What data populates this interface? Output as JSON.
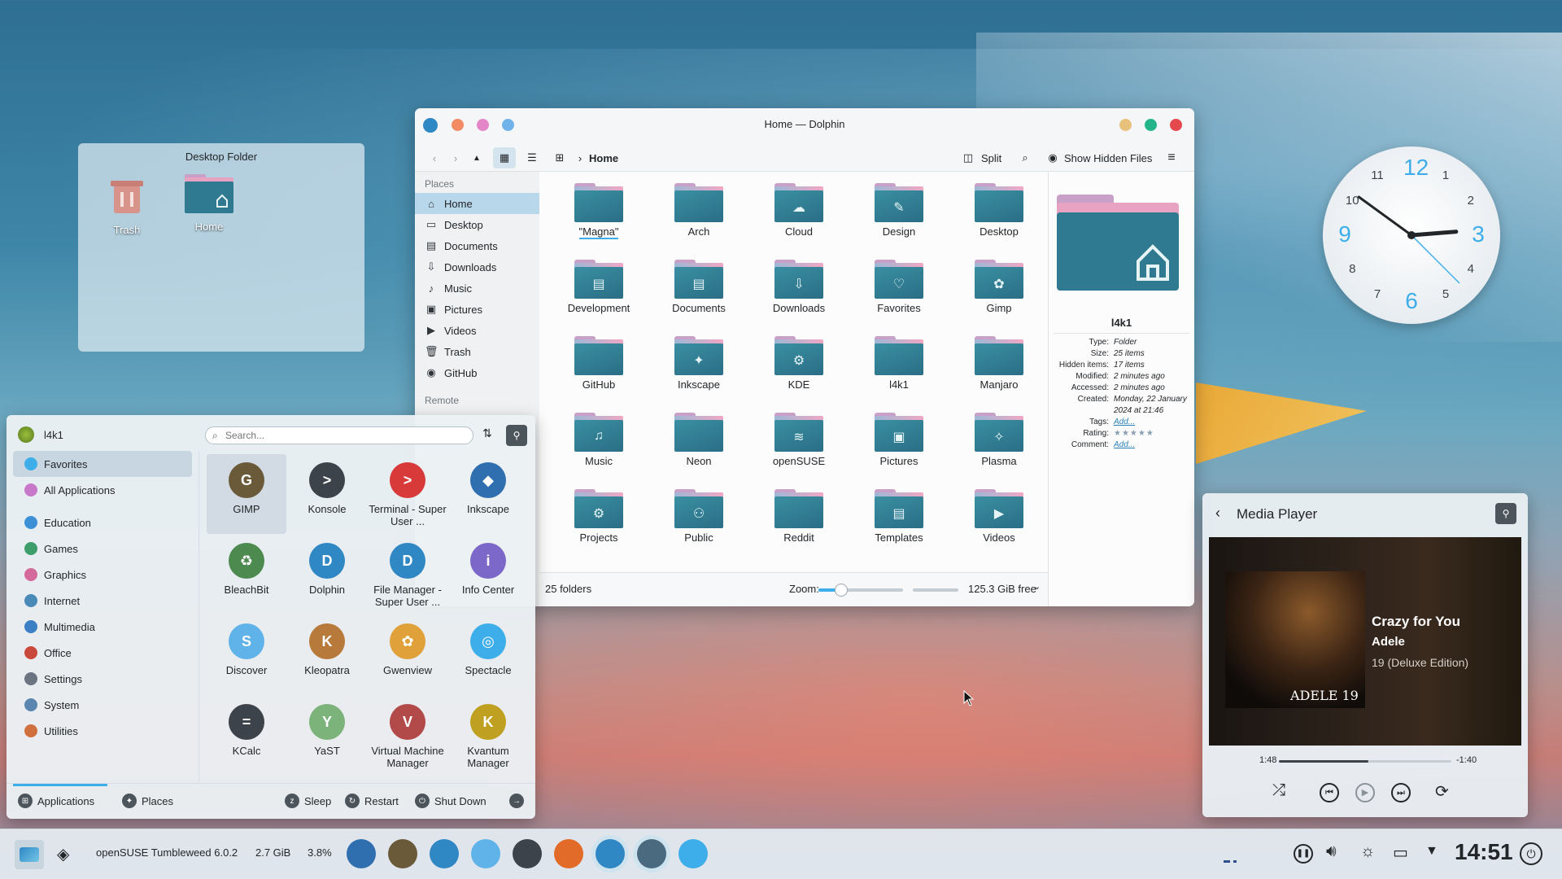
{
  "desktop_folder": {
    "title": "Desktop Folder",
    "items": [
      {
        "label": "Trash",
        "icon": "trash-icon"
      },
      {
        "label": "Home",
        "icon": "home-folder-icon"
      }
    ]
  },
  "dolphin": {
    "title": "Home — Dolphin",
    "breadcrumb": "Home",
    "toolbar": {
      "split": "Split",
      "show_hidden": "Show Hidden Files"
    },
    "places_header": "Places",
    "places": [
      {
        "label": "Home",
        "icon": "home-icon",
        "selected": true
      },
      {
        "label": "Desktop",
        "icon": "desktop-icon"
      },
      {
        "label": "Documents",
        "icon": "documents-icon"
      },
      {
        "label": "Downloads",
        "icon": "downloads-icon"
      },
      {
        "label": "Music",
        "icon": "music-icon"
      },
      {
        "label": "Pictures",
        "icon": "pictures-icon"
      },
      {
        "label": "Videos",
        "icon": "videos-icon"
      },
      {
        "label": "Trash",
        "icon": "trash-icon"
      },
      {
        "label": "GitHub",
        "icon": "github-icon"
      }
    ],
    "remote_header": "Remote",
    "folders": [
      "\"Magna\"",
      "Arch",
      "Cloud",
      "Design",
      "Desktop",
      "Development",
      "Documents",
      "Downloads",
      "Favorites",
      "Gimp",
      "GitHub",
      "Inkscape",
      "KDE",
      "l4k1",
      "Manjaro",
      "Music",
      "Neon",
      "openSUSE",
      "Pictures",
      "Plasma",
      "Projects",
      "Public",
      "Reddit",
      "Templates",
      "Videos"
    ],
    "status": {
      "count": "25 folders",
      "zoom_label": "Zoom:",
      "free": "125.3 GiB free"
    },
    "info": {
      "name": "l4k1",
      "rows": [
        {
          "k": "Type:",
          "v": "Folder"
        },
        {
          "k": "Size:",
          "v": "25 items"
        },
        {
          "k": "Hidden items:",
          "v": "17 items"
        },
        {
          "k": "Modified:",
          "v": "2 minutes ago"
        },
        {
          "k": "Accessed:",
          "v": "2 minutes ago"
        },
        {
          "k": "Created:",
          "v": "Monday, 22 January 2024 at 21:46"
        },
        {
          "k": "Tags:",
          "v": "Add..."
        },
        {
          "k": "Rating:",
          "v": "★★★★★"
        },
        {
          "k": "Comment:",
          "v": "Add..."
        }
      ]
    }
  },
  "start_menu": {
    "user": "l4k1",
    "search_placeholder": "Search...",
    "categories": [
      "Favorites",
      "All Applications",
      "Education",
      "Games",
      "Graphics",
      "Internet",
      "Multimedia",
      "Office",
      "Settings",
      "System",
      "Utilities"
    ],
    "category_colors": [
      "#3daee9",
      "#c778c8",
      "#3d8fd6",
      "#3e9e6b",
      "#d36a9b",
      "#4a8ab8",
      "#3b7fc4",
      "#c94a3c",
      "#6b7480",
      "#5a86b0",
      "#d1703f"
    ],
    "apps": [
      {
        "name": "GIMP",
        "color": "#6b5a3a",
        "glyph": "G"
      },
      {
        "name": "Konsole",
        "color": "#3d434a",
        "glyph": ">"
      },
      {
        "name": "Terminal - Super User ...",
        "color": "#d83a3a",
        "glyph": ">"
      },
      {
        "name": "Inkscape",
        "color": "#2f6fb0",
        "glyph": "◆"
      },
      {
        "name": "BleachBit",
        "color": "#4c8a50",
        "glyph": "♻"
      },
      {
        "name": "Dolphin",
        "color": "#2f87c4",
        "glyph": "D"
      },
      {
        "name": "File Manager - Super User ...",
        "color": "#2f87c4",
        "glyph": "D"
      },
      {
        "name": "Info Center",
        "color": "#7b68c8",
        "glyph": "i"
      },
      {
        "name": "Discover",
        "color": "#5fb3e8",
        "glyph": "S"
      },
      {
        "name": "Kleopatra",
        "color": "#b87a3a",
        "glyph": "K"
      },
      {
        "name": "Gwenview",
        "color": "#e0a03a",
        "glyph": "✿"
      },
      {
        "name": "Spectacle",
        "color": "#3daee9",
        "glyph": "◎"
      },
      {
        "name": "KCalc",
        "color": "#3d434a",
        "glyph": "="
      },
      {
        "name": "YaST",
        "color": "#7bb37a",
        "glyph": "Y"
      },
      {
        "name": "Virtual Machine Manager",
        "color": "#b34a4a",
        "glyph": "V"
      },
      {
        "name": "Kvantum Manager",
        "color": "#c0a020",
        "glyph": "K"
      }
    ],
    "bottom": {
      "applications": "Applications",
      "places": "Places",
      "sleep": "Sleep",
      "restart": "Restart",
      "shutdown": "Shut Down"
    }
  },
  "clock": {
    "time_hours": 2,
    "time_minutes": 51
  },
  "media_player": {
    "title": "Media Player",
    "song": "Crazy for You",
    "artist": "Adele",
    "album": "19 (Deluxe Edition)",
    "album_art_text": "ADELE 19",
    "elapsed": "1:48",
    "remaining": "-1:40",
    "progress": 0.52
  },
  "taskbar": {
    "os_label": "openSUSE Tumbleweed 6.0.2",
    "memory": "2.7 GiB",
    "cpu": "3.8%",
    "time": "14:51",
    "apps": [
      {
        "name": "inkscape-task-icon",
        "color": "#2f6fb0"
      },
      {
        "name": "gimp-task-icon",
        "color": "#6b5a3a"
      },
      {
        "name": "system-monitor-task-icon",
        "color": "#2f87c4"
      },
      {
        "name": "discover-task-icon",
        "color": "#5fb3e8"
      },
      {
        "name": "settings-task-icon",
        "color": "#3d434a"
      },
      {
        "name": "firefox-task-icon",
        "color": "#e36b2a"
      },
      {
        "name": "dolphin-task-icon",
        "color": "#2f87c4"
      },
      {
        "name": "kcalc-task-icon",
        "color": "#4a6a80"
      },
      {
        "name": "media-task-icon",
        "color": "#3daee9"
      }
    ]
  }
}
